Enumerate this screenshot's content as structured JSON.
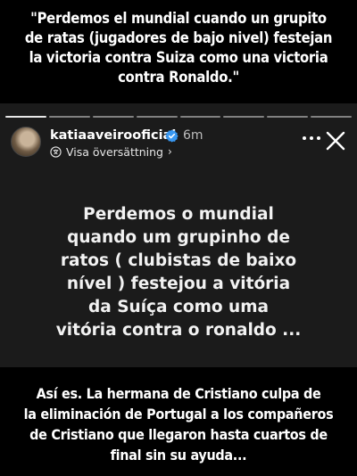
{
  "caption_top": {
    "lines": [
      "\"Perdemos el mundial cuando un grupito",
      "de ratas (jugadores de bajo nivel) festejan",
      "la victoria contra Suiza como una victoria",
      "contra Ronaldo.\""
    ]
  },
  "story": {
    "progress_segments": 8,
    "active_segment": 1,
    "username": "katiaaveirooficial",
    "time": "6m",
    "translate_label": "Visa översättning",
    "icons": [
      "avatar",
      "verified-badge-icon",
      "translate-icon",
      "chevron-right-icon",
      "more-icon",
      "close-icon"
    ],
    "text_lines": [
      "Perdemos o mundial",
      "quando um grupinho de",
      "ratos ( clubistas de baixo",
      "nível ) festejou a vitória",
      "da Suíça como uma",
      "vitória contra o ronaldo ..."
    ],
    "colors": {
      "background": "#1b1b1b",
      "verified": "#3897f0"
    }
  },
  "caption_bottom": {
    "lines": [
      "Así es. La hermana de Cristiano culpa de",
      "la eliminación de Portugal a los compañeros",
      "de Cristiano que llegaron hasta cuartos de",
      "final sin  su ayuda..."
    ]
  }
}
